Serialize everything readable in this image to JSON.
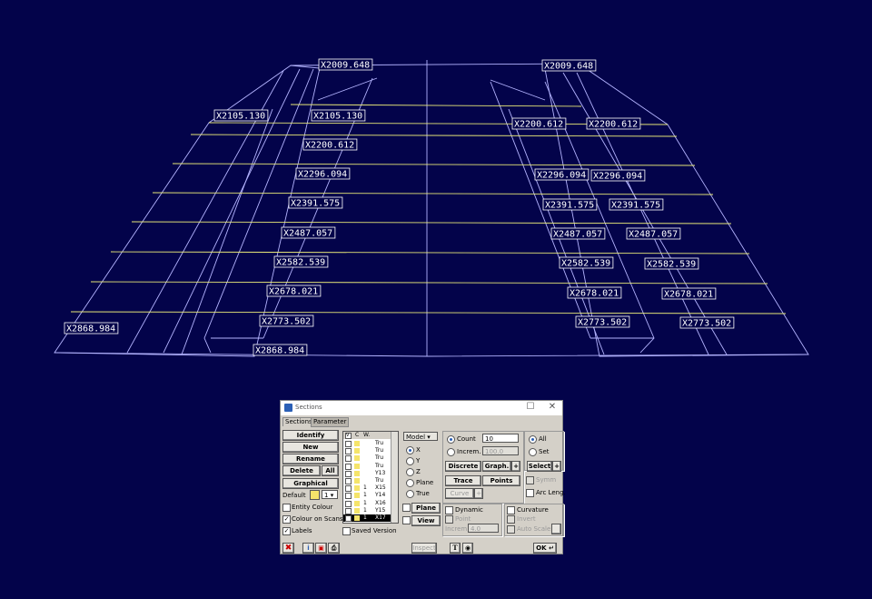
{
  "viewport": {
    "labels": [
      {
        "id": "l1",
        "text": "X2009.648"
      },
      {
        "id": "l2",
        "text": "X2009.648"
      },
      {
        "id": "l3",
        "text": "X2105.130"
      },
      {
        "id": "l4",
        "text": "X2105.130"
      },
      {
        "id": "l5",
        "text": "X2200.612"
      },
      {
        "id": "l6",
        "text": "X2200.612"
      },
      {
        "id": "l7",
        "text": "X2200.612"
      },
      {
        "id": "l8",
        "text": "X2296.094"
      },
      {
        "id": "l9",
        "text": "X2296.094"
      },
      {
        "id": "l10",
        "text": "X2296.094"
      },
      {
        "id": "l11",
        "text": "X2391.575"
      },
      {
        "id": "l12",
        "text": "X2391.575"
      },
      {
        "id": "l13",
        "text": "X2391.575"
      },
      {
        "id": "l14",
        "text": "X2487.057"
      },
      {
        "id": "l15",
        "text": "X2487.057"
      },
      {
        "id": "l16",
        "text": "X2487.057"
      },
      {
        "id": "l17",
        "text": "X2582.539"
      },
      {
        "id": "l18",
        "text": "X2582.539"
      },
      {
        "id": "l19",
        "text": "X2582.539"
      },
      {
        "id": "l20",
        "text": "X2678.021"
      },
      {
        "id": "l21",
        "text": "X2678.021"
      },
      {
        "id": "l22",
        "text": "X2678.021"
      },
      {
        "id": "l23",
        "text": "X2868.984"
      },
      {
        "id": "l24",
        "text": "X2773.502"
      },
      {
        "id": "l25",
        "text": "X2773.502"
      },
      {
        "id": "l26",
        "text": "X2773.502"
      },
      {
        "id": "l27",
        "text": "X2868.984"
      }
    ],
    "colors": {
      "background": "#03034a",
      "wire": "#b4b4ff",
      "section": "#e8e878",
      "label": "#ffffff"
    }
  },
  "dialog": {
    "title": "Sections",
    "tabs": [
      "Sections",
      "Parameter"
    ],
    "buttons": {
      "identify": "Identify",
      "new": "New",
      "rename": "Rename",
      "delete": "Delete",
      "all": "All",
      "graphical": "Graphical",
      "discrete": "Discrete",
      "graph": "Graph.",
      "plus": "+",
      "trace": "Trace",
      "points": "Points",
      "select": "Select",
      "curve": "Curve",
      "plane": "Plane",
      "view": "View",
      "inspect": "Inspect",
      "ok": "OK"
    },
    "default_label": "Default",
    "default_value": "1",
    "model_select": "Model",
    "axis_options": [
      "X",
      "Y",
      "Z",
      "Plane",
      "True"
    ],
    "count_label": "Count",
    "count_value": "10",
    "increm_label": "Increm.",
    "increm_value": "100.0",
    "all_label": "All",
    "set_label": "Set",
    "symm_label": "Symm",
    "arc_leng_label": "Arc Leng.",
    "dynamic_label": "Dynamic",
    "point_label": "Point",
    "increm2_label": "Increm.",
    "increm2_value": "4.0",
    "curvature_label": "Curvature",
    "invert_label": "Invert",
    "auto_scale_label": "Auto Scale",
    "entity_colour": "Entity Colour",
    "colour_on_scans": "Colour on Scans",
    "labels": "Labels",
    "saved_version": "Saved Version",
    "list_header": {
      "v": "V",
      "c": "C",
      "w": "W."
    },
    "list_rows": [
      {
        "w": "",
        "name": "Tru"
      },
      {
        "w": "",
        "name": "Tru"
      },
      {
        "w": "",
        "name": "Tru"
      },
      {
        "w": "",
        "name": "Tru"
      },
      {
        "w": "",
        "name": "Y13"
      },
      {
        "w": "",
        "name": "Tru"
      },
      {
        "w": "1",
        "name": "X15"
      },
      {
        "w": "1",
        "name": "Y14"
      },
      {
        "w": "1",
        "name": "X16"
      },
      {
        "w": "1",
        "name": "Y15"
      },
      {
        "w": "1",
        "name": "X17"
      }
    ]
  }
}
